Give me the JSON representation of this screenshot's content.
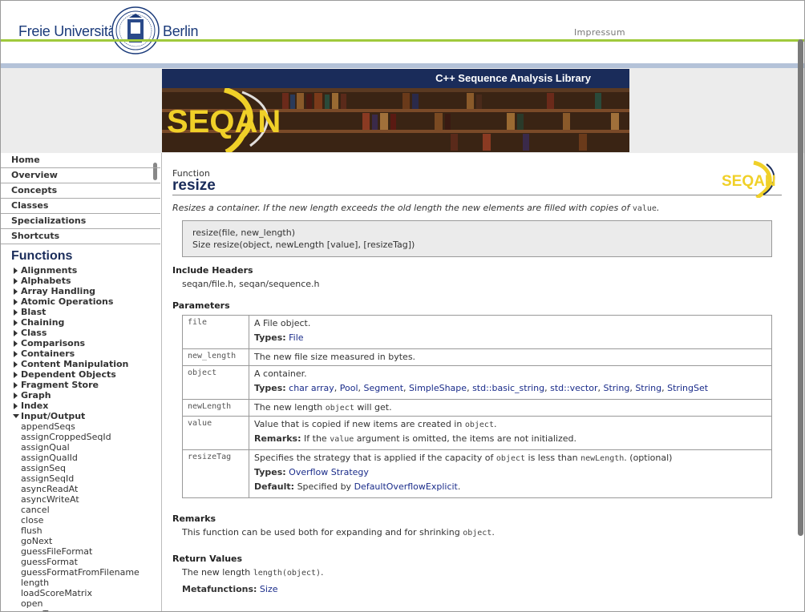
{
  "header": {
    "university_left": "Freie Universität",
    "university_right": "Berlin",
    "impressum": "Impressum"
  },
  "banner": {
    "title": "C++ Sequence Analysis Library",
    "logo_text": "SEQAN"
  },
  "sidebar": {
    "nav": [
      {
        "label": "Home"
      },
      {
        "label": "Overview"
      },
      {
        "label": "Concepts"
      },
      {
        "label": "Classes"
      },
      {
        "label": "Specializations"
      },
      {
        "label": "Shortcuts"
      }
    ],
    "functions_heading": "Functions",
    "categories": [
      {
        "label": "Alignments"
      },
      {
        "label": "Alphabets"
      },
      {
        "label": "Array Handling"
      },
      {
        "label": "Atomic Operations"
      },
      {
        "label": "Blast"
      },
      {
        "label": "Chaining"
      },
      {
        "label": "Class"
      },
      {
        "label": "Comparisons"
      },
      {
        "label": "Containers"
      },
      {
        "label": "Content Manipulation"
      },
      {
        "label": "Dependent Objects"
      },
      {
        "label": "Fragment Store"
      },
      {
        "label": "Graph"
      },
      {
        "label": "Index"
      },
      {
        "label": "Input/Output"
      }
    ],
    "io_items": [
      {
        "label": "appendSeqs"
      },
      {
        "label": "assignCroppedSeqId"
      },
      {
        "label": "assignQual"
      },
      {
        "label": "assignQualId"
      },
      {
        "label": "assignSeq"
      },
      {
        "label": "assignSeqId"
      },
      {
        "label": "asyncReadAt"
      },
      {
        "label": "asyncWriteAt"
      },
      {
        "label": "cancel"
      },
      {
        "label": "close"
      },
      {
        "label": "flush"
      },
      {
        "label": "goNext"
      },
      {
        "label": "guessFileFormat"
      },
      {
        "label": "guessFormat"
      },
      {
        "label": "guessFormatFromFilename"
      },
      {
        "label": "length"
      },
      {
        "label": "loadScoreMatrix"
      },
      {
        "label": "open"
      },
      {
        "label": "openTemp"
      }
    ]
  },
  "content": {
    "kind": "Function",
    "title": "resize",
    "summary_text": "Resizes a container. If the new length exceeds the old length the new elements are filled with copies of",
    "summary_code": "value",
    "summary_end": ".",
    "signatures": [
      "resize(file, new_length)",
      "Size resize(object, newLength [value], [resizeTag])"
    ],
    "include_headers_heading": "Include Headers",
    "include_headers": "seqan/file.h, seqan/sequence.h",
    "parameters_heading": "Parameters",
    "params": {
      "file": {
        "name": "file",
        "desc": "A File object.",
        "types_label": "Types:",
        "types": [
          "File"
        ]
      },
      "new_length": {
        "name": "new_length",
        "desc": "The new file size measured in bytes."
      },
      "object": {
        "name": "object",
        "desc": "A container.",
        "types_label": "Types:",
        "types": [
          "char array",
          "Pool",
          "Segment",
          "SimpleShape",
          "std::basic_string",
          "std::vector",
          "String",
          "String",
          "StringSet"
        ]
      },
      "newLength": {
        "name": "newLength",
        "desc_pre": "The new length",
        "desc_code": "object",
        "desc_post": "will get."
      },
      "value": {
        "name": "value",
        "desc_pre": "Value that is copied if new items are created in",
        "desc_code": "object",
        "desc_post": ".",
        "remarks_label": "Remarks:",
        "remarks_pre": "If the",
        "remarks_code": "value",
        "remarks_post": "argument is omitted, the items are not initialized."
      },
      "resizeTag": {
        "name": "resizeTag",
        "desc_pre": "Specifies the strategy that is applied if the capacity of",
        "desc_code1": "object",
        "desc_mid": "is less than",
        "desc_code2": "newLength",
        "desc_post": ". (optional)",
        "types_label": "Types:",
        "types": [
          "Overflow Strategy"
        ],
        "default_label": "Default:",
        "default_pre": "Specified by",
        "default_link": "DefaultOverflowExplicit",
        "default_post": "."
      }
    },
    "remarks_heading": "Remarks",
    "remarks_text": "This function can be used both for expanding and for shrinking",
    "remarks_code": "object",
    "remarks_end": ".",
    "return_heading": "Return Values",
    "return_text": "The new length",
    "return_code": "length(object)",
    "return_end": ".",
    "metafunctions_label": "Metafunctions:",
    "metafunctions_link": "Size"
  }
}
